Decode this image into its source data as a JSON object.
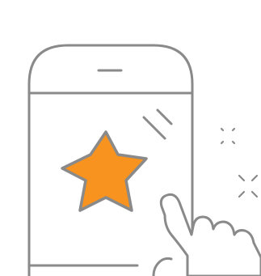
{
  "illustration": {
    "subject": "phone-star-rating-tap",
    "icons": [
      "smartphone-icon",
      "star-icon",
      "pointing-hand-icon",
      "sparkle-icon",
      "screen-glare-icon"
    ]
  },
  "colors": {
    "outline": "#8a8a8a",
    "star_fill": "#f7931e",
    "background": "#ffffff"
  }
}
